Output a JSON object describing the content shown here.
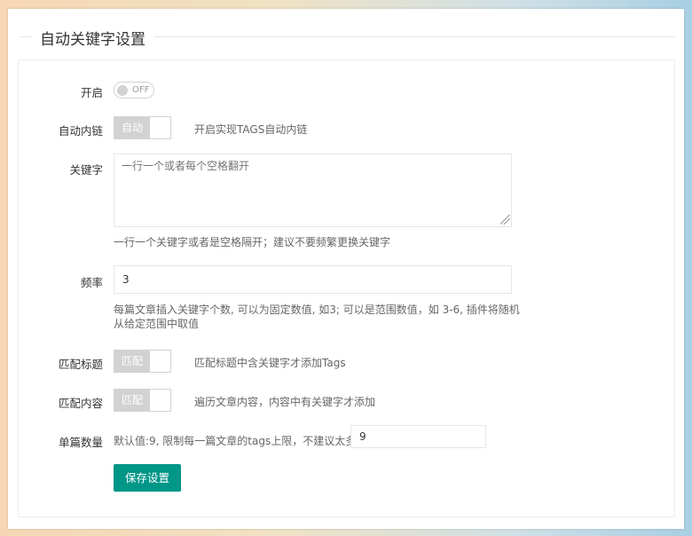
{
  "page": {
    "legend": "自动关键字设置"
  },
  "form": {
    "enable": {
      "label": "开启",
      "switch_text": "OFF"
    },
    "auto_link": {
      "label": "自动内链",
      "checkbox_text": "自动",
      "hint": "开启实现TAGS自动内链"
    },
    "keywords": {
      "label": "关键字",
      "placeholder": "一行一个或者每个空格翻开",
      "hint": "一行一个关键字或者是空格隔开；建议不要频繁更换关键字"
    },
    "frequency": {
      "label": "频率",
      "value": "3",
      "hint_line1": "每篇文章插入关键字个数, 可以为固定数值, 如3; 可以是范围数值，如 3-6, 插件将随机",
      "hint_line2": "从给定范围中取值"
    },
    "match_title": {
      "label": "匹配标题",
      "checkbox_text": "匹配",
      "hint": "匹配标题中含关键字才添加Tags"
    },
    "match_content": {
      "label": "匹配内容",
      "checkbox_text": "匹配",
      "hint": "遍历文章内容，内容中有关键字才添加"
    },
    "max_count": {
      "label": "单篇数量",
      "hint": "默认值:9, 限制每一篇文章的tags上限，不建议太多",
      "value": "9"
    },
    "save_label": "保存设置"
  },
  "colors": {
    "primary": "#009688",
    "disabled": "#d2d2d2"
  }
}
